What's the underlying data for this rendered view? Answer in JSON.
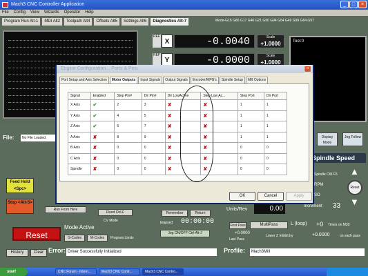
{
  "window": {
    "title": "Mach3 CNC Controller Application"
  },
  "menu": [
    "File",
    "Config",
    "View",
    "Wizards",
    "Operator",
    "Help"
  ],
  "main_tabs": [
    "Program Run Alt-1",
    "MDI Alt2",
    "Toolpath Alt4",
    "Offsets Alt5",
    "Settings Alt6",
    "Diagnostics Alt-7"
  ],
  "gcode_line": "Mode-G15  G80 G17 G40 G21 G90 G94 G54 G49 G99 G64 G97",
  "dro": {
    "x": {
      "label": "X",
      "ref": "REF",
      "value": "-0.0040",
      "scale_label": "Scale",
      "scale": "+1.0000"
    },
    "y": {
      "label": "Y",
      "ref": "REF",
      "value": "-0.0000",
      "scale_label": "Scale",
      "scale": "+1.0000"
    }
  },
  "tool_panel": {
    "label": "Tool:0"
  },
  "file": {
    "label": "File:",
    "value": "No File Loaded."
  },
  "left_buttons": {
    "feed_hold": "Feed Hold <Spc>",
    "stop": "Stop <Alt-S>",
    "run_from_here": "Run From Here",
    "flood": "Flood Ctrl-F"
  },
  "reset": {
    "label": "Reset"
  },
  "mode": {
    "label": "Mode Active",
    "cv_mode": "CV Mode",
    "btn1": "G-Codes",
    "btn2": "M-Codes",
    "program_limits": "Program Limits"
  },
  "bottom_center": {
    "remember": "Remember",
    "return": "Return",
    "elapsed_label": "Elapsed",
    "elapsed": "00:00:00",
    "jog": "Jog ON/OFF Ctrl-Alt-J",
    "units_label": "Units/Rev",
    "units_value": "0.00"
  },
  "spindle": {
    "label": "Spindle Speed",
    "display_mode": "Display Mode",
    "jog_follow": "Jog Follow",
    "cw": "Spindle CW F5",
    "rpm": "RPM",
    "so": "SO",
    "reset": "Reset",
    "increment_label": "Increment",
    "increment_value": "33"
  },
  "multipass": {
    "first": "First Pass",
    "value": "+0.0000",
    "label": "MultiPass",
    "loop": "L (loop)",
    "plus0": "+0",
    "times_on_m30": "Times on M30",
    "last_pass": "Last Pass",
    "lower_z": "Lower Z Inhibit by",
    "lower_z_value": "+0.0000",
    "on_each_pass": "on each pass"
  },
  "status": {
    "history": "History",
    "clear": "Clear",
    "error_label": "Error:",
    "message": "Driver Successfully Initialized",
    "profile_label": "Profile:",
    "profile": "Mach3Mill"
  },
  "taskbar": {
    "start": "start",
    "tasks": [
      "CNC Forum - Intern...",
      "Mach3 CNC Contr...",
      "Mach3 CNC Contro..."
    ]
  },
  "dialog": {
    "title": "Engine Configuration... Ports & Pins",
    "tabs": [
      "Port Setup and Axis Selection",
      "Motor Outputs",
      "Input Signals",
      "Output Signals",
      "Encoder/MPG's",
      "Spindle Setup",
      "Mill Options"
    ],
    "columns": [
      "Signal",
      "Enabled",
      "Step Pin#",
      "Dir Pin#",
      "Dir LowActive",
      "Step Low Ac...",
      "Step Port",
      "Dir Port"
    ],
    "rows": [
      {
        "signal": "X Axis",
        "enabled": "check",
        "step": "2",
        "dir": "3",
        "dir_low": "x",
        "step_low": "x",
        "step_port": "1",
        "dir_port": "1"
      },
      {
        "signal": "Y Axis",
        "enabled": "check",
        "step": "4",
        "dir": "5",
        "dir_low": "x",
        "step_low": "x",
        "step_port": "1",
        "dir_port": "1"
      },
      {
        "signal": "Z Axis",
        "enabled": "check",
        "step": "6",
        "dir": "7",
        "dir_low": "x",
        "step_low": "x",
        "step_port": "1",
        "dir_port": "1"
      },
      {
        "signal": "A Axis",
        "enabled": "x",
        "step": "8",
        "dir": "9",
        "dir_low": "x",
        "step_low": "x",
        "step_port": "1",
        "dir_port": "1"
      },
      {
        "signal": "B Axis",
        "enabled": "x",
        "step": "0",
        "dir": "0",
        "dir_low": "x",
        "step_low": "x",
        "step_port": "0",
        "dir_port": "0"
      },
      {
        "signal": "C Axis",
        "enabled": "x",
        "step": "0",
        "dir": "0",
        "dir_low": "x",
        "step_low": "x",
        "step_port": "0",
        "dir_port": "0"
      },
      {
        "signal": "Spindle",
        "enabled": "x",
        "step": "0",
        "dir": "0",
        "dir_low": "x",
        "step_low": "x",
        "step_port": "0",
        "dir_port": "0"
      }
    ],
    "buttons": {
      "ok": "OK",
      "cancel": "Cancel",
      "apply": "Apply"
    }
  },
  "icon_glyphs": {
    "check": "✔",
    "x": "✘"
  },
  "colors": {
    "reset_red": "#c41212",
    "dro_bg": "#111111",
    "titlebar_blue": "#2352c4"
  }
}
